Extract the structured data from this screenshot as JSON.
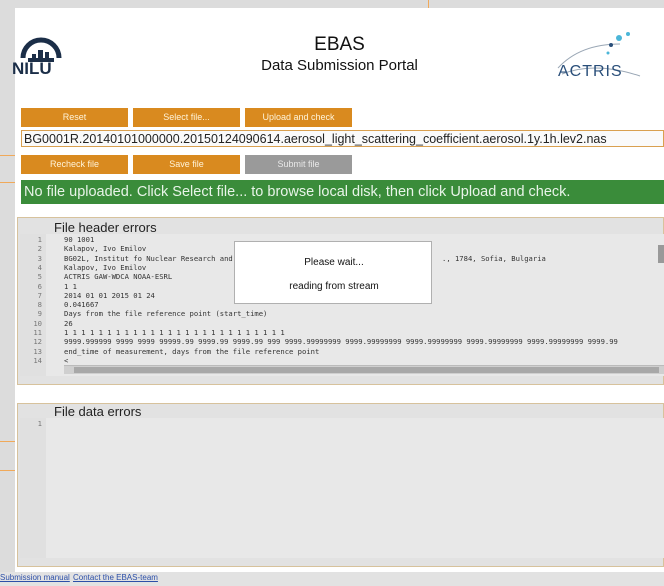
{
  "header": {
    "logo_text": "NILU",
    "title": "EBAS",
    "subtitle": "Data Submission Portal",
    "partner_logo": "ACTRIS"
  },
  "toolbar": {
    "reset_label": "Reset",
    "select_file_label": "Select file...",
    "upload_check_label": "Upload and check",
    "recheck_label": "Recheck file",
    "save_label": "Save file",
    "submit_label": "Submit file"
  },
  "filename": "BG0001R.20140101000000.20150124090614.aerosol_light_scattering_coefficient.aerosol.1y.1h.lev2.nas",
  "status": "No file uploaded. Click Select file... to browse local disk, then click Upload and check.",
  "header_errors": {
    "title": "File header errors",
    "lines": [
      {
        "n": "1",
        "text": "90 1001"
      },
      {
        "n": "2",
        "text": "Kalapov, Ivo Emilov"
      },
      {
        "n": "3",
        "text": "BG02L, Institut fo Nuclear Research and"
      },
      {
        "n": "4",
        "text": "Kalapov, Ivo Emilov"
      },
      {
        "n": "5",
        "text": "ACTRIS GAW-WDCA NOAA-ESRL"
      },
      {
        "n": "6",
        "text": "1 1"
      },
      {
        "n": "7",
        "text": "2014 01 01 2015 01 24"
      },
      {
        "n": "8",
        "text": "0.041667"
      },
      {
        "n": "9",
        "text": "Days from the file reference point (start_time)"
      },
      {
        "n": "10",
        "text": "26"
      },
      {
        "n": "11",
        "text": "1 1 1 1 1 1 1 1 1 1 1 1 1 1 1 1 1 1 1 1 1 1 1 1 1 1"
      },
      {
        "n": "12",
        "text": "9999.999999 9999 9999 99999.99 9999.99 9999.99 999 9999.99999999 9999.99999999 9999.99999999 9999.99999999 9999.99999999 9999.99"
      },
      {
        "n": "13",
        "text": "end_time of measurement, days from the file reference point"
      },
      {
        "n": "14",
        "text": "<"
      }
    ],
    "line3_tail": "., 1784, Sofia, Bulgaria"
  },
  "data_errors": {
    "title": "File data errors",
    "lines": [
      {
        "n": "1",
        "text": ""
      }
    ]
  },
  "modal": {
    "title": "Please wait...",
    "message": "reading from stream"
  },
  "footer": {
    "manual_label": "Submission manual",
    "contact_label": "Contact the EBAS-team"
  }
}
